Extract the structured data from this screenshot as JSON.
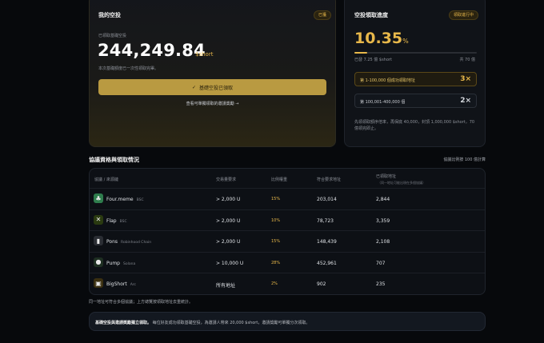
{
  "airdrop": {
    "title": "我的空投",
    "badge": "已獲",
    "claimed_label": "已領取基礎空投",
    "amount": "244,249.84",
    "unit": "$short",
    "note": "本次基礎額度已一次性領取完畢。",
    "button_label": "基礎空投已領取",
    "invite_link": "查看可單獨領取的邀請獎勵"
  },
  "progress": {
    "title": "空投領取進度",
    "badge": "領取進行中",
    "percent_value": "10.35",
    "percent_sign": "%",
    "fraction": 0.1035,
    "claimed_text": "已發 7.25 億 $short",
    "total_text": "共 70 億",
    "tiers": [
      {
        "label": "第 1-100,000 個成功領取地址",
        "mult": "3×",
        "active": true
      },
      {
        "label": "第 100,001-400,000 個",
        "mult": "2×",
        "active": false
      }
    ],
    "note": "先領領取額序倍率，再保底 40,000，封頂 1,000,000 $short，70 億領完即止。"
  },
  "section": {
    "title": "協議資格與領取情況",
    "right_note": "協議比例按 100 億計算"
  },
  "table": {
    "headers": [
      "協議 / 來源鏈",
      "交易量要求",
      "比例權重",
      "符合要求地址",
      "已領取地址"
    ],
    "header_sub": "（同一地址可能出現在多個協議）",
    "rows": [
      {
        "name": "Four.meme",
        "chain": "BSC",
        "req": "> 2,000 U",
        "weight": "15%",
        "eligible": "203,014",
        "claimed": "2,844",
        "logo_color": "#2f7d4d",
        "logo_icon": "frog-icon",
        "logo_char": "♣"
      },
      {
        "name": "Flap",
        "chain": "BSC",
        "req": "> 2,000 U",
        "weight": "10%",
        "eligible": "78,723",
        "claimed": "3,359",
        "logo_color": "#2a3a10",
        "logo_icon": "flap-icon",
        "logo_char": "✕"
      },
      {
        "name": "Pons",
        "chain": "Robinhood Chain",
        "req": "> 2,000 U",
        "weight": "15%",
        "eligible": "148,439",
        "claimed": "2,108",
        "logo_color": "#2a2d33",
        "logo_icon": "pons-icon",
        "logo_char": "▮"
      },
      {
        "name": "Pump",
        "chain": "Solana",
        "req": "> 10,000 U",
        "weight": "28%",
        "eligible": "452,961",
        "claimed": "707",
        "logo_color": "#1e2f22",
        "logo_icon": "pill-icon",
        "logo_char": "●"
      },
      {
        "name": "BigShort",
        "chain": "Arc",
        "req": "所有地址",
        "weight": "2%",
        "eligible": "902",
        "claimed": "235",
        "logo_color": "#3a2f10",
        "logo_icon": "bigshort-icon",
        "logo_char": "▣"
      }
    ]
  },
  "footnote": "同一地址可符合多個協議；上方總覽按領取地址去重統計。",
  "bottom": {
    "bold": "基礎空投與邀請獎勵獨立領取。",
    "text": "每位好友成功領取基礎空投，為邀請人帶來 20,000 $short，邀請獎勵可單獨分次領取。"
  }
}
